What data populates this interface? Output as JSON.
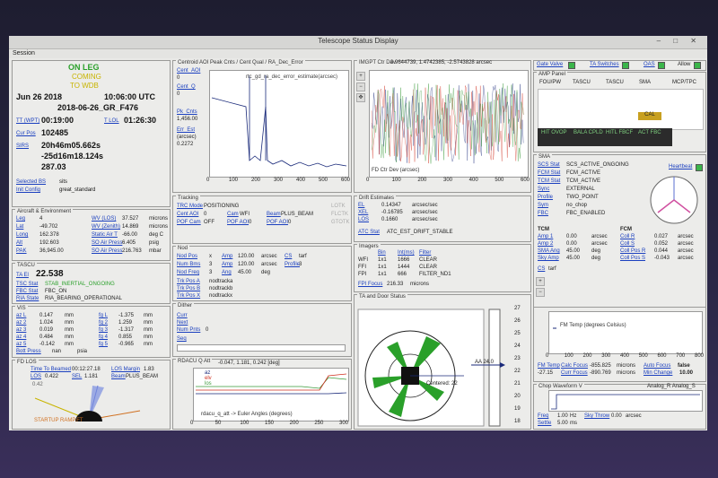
{
  "window": {
    "title": "Telescope Status Display",
    "menu": "Session"
  },
  "flight": {
    "leg_status": "ON LEG",
    "status_line2": "COMING",
    "status_line3": "TO WDB",
    "date": "Jun 26 2018",
    "time_utc": "10:06:00 UTC",
    "flight_id": "2018-06-26_GR_F476",
    "tt_label": "TT (WPT)",
    "tt": "00:19:00",
    "tlol_label": "T LOL",
    "tlol": "01:26:30",
    "curpos_label": "Cur Pos",
    "curpos": "102485",
    "sirs_label": "SIRS",
    "ra": "20h46m05.662s",
    "dec": "-25d16m18.124s",
    "pa": "287.03",
    "sel_label": "Selected BS",
    "sel_val": "sits",
    "init_label": "Init Config",
    "init_val": "great_standard"
  },
  "aircraft": {
    "title": "Aircraft & Environment",
    "rows": [
      [
        "Leg",
        "4",
        "WV (LOS)",
        "37.527",
        "microns"
      ],
      [
        "Lat",
        "-49.702",
        "WV (Zenith)",
        "14.869",
        "microns"
      ],
      [
        "Long",
        "162.378",
        "Static Air T",
        "-66.00",
        "deg C"
      ],
      [
        "Alt",
        "192.603",
        "SO Air Press",
        "6.405",
        "psig"
      ],
      [
        "PAK",
        "36,945.00",
        "SO Air Press",
        "216.763",
        "mbar"
      ]
    ]
  },
  "tasco": {
    "title": "TASCU",
    "ta_label": "TA El",
    "ta_val": "22.538",
    "tsc_label": "TSC Stat",
    "tsc_val": "STAB_INERTIAL_ONGOING",
    "fbc_label": "FBC Stat",
    "fbc_val": "FBC_ON",
    "ria_label": "RIA State",
    "ria_val": "RIA_BEARING_OPERATIONAL"
  },
  "vis": {
    "title": "VIS",
    "rows": [
      [
        "az L",
        "0.147",
        "mm",
        "fg L",
        "-1.375",
        "mm"
      ],
      [
        "az 2",
        "1.024",
        "mm",
        "fg 2",
        "1.259",
        "mm"
      ],
      [
        "az 3",
        "0.019",
        "mm",
        "fg 3",
        "-1.317",
        "mm"
      ],
      [
        "az 4",
        "0.484",
        "mm",
        "fg 4",
        "0.855",
        "mm"
      ],
      [
        "az 5",
        "-0.142",
        "mm",
        "fg 5",
        "-0.965",
        "mm"
      ]
    ],
    "bott_label": "Bott Press",
    "bott_val": "nan",
    "bott_unit": "psia"
  },
  "fdlos": {
    "title": "FD LOS",
    "ttb_label": "Time To Beamed",
    "ttb_val": "00:12:27.18",
    "losm_label": "LOS Margin",
    "losm_val": "1.83",
    "los_label": "LOS",
    "los_val": "0.422",
    "sel_label": "SEL",
    "sel_val": "1.181",
    "beam_label": "Beam",
    "beam_val": "PLUS_BEAM",
    "gauge_value": "0.42",
    "gauge_note": "STARTUP RAMP.FT"
  },
  "centroid": {
    "title": "Centroid AOI Peak Cnts / Cent Qual / RA_Dec_Error",
    "labels": [
      "Cent_AOI",
      "0",
      "Cent_Q",
      "0",
      "Pk_Cnts",
      "1,456.00",
      "Err_Est",
      "(arcsec)",
      "0.2272"
    ],
    "legend": "rtc_gd_ra_dec_error_estimate(arcsec)",
    "xticks": [
      "0",
      "100",
      "200",
      "300",
      "400",
      "500",
      "600"
    ]
  },
  "tracking": {
    "title": "Tracking",
    "trc_label": "TRC Mode",
    "trc_val": "POSITIONING",
    "cent_label": "Cent AOI",
    "cent_val": "0",
    "cam_label": "Cam",
    "cam_val": "WFI",
    "beam_label": "Beam",
    "beam_val": "PLUS_BEAM",
    "pof_label": "POF Cam",
    "pof_val": "OFF",
    "pofaoi_label": "POF AOI",
    "pofaoi_val": "0",
    "pofaoi2_label": "POF AOI",
    "pofaoi2_val": "0",
    "lotk": "LOTK",
    "flctk": "FLCTK",
    "gtotk": "GTOTK"
  },
  "nod": {
    "title": "Nod",
    "rows": [
      [
        "Nod Pos",
        "x",
        "Amp",
        "120.00",
        "arcsec",
        "CS",
        "tarf"
      ],
      [
        "Num Bms",
        "3",
        "Amp",
        "120.00",
        "arcsec",
        "Profile",
        "3"
      ],
      [
        "Nod Freq",
        "3",
        "Ang",
        "45.00",
        "deg",
        "",
        ""
      ]
    ],
    "trk": [
      [
        "Trk Pos A",
        "nodtracka"
      ],
      [
        "Trk Pos B",
        "nodtrackb"
      ],
      [
        "Trk Pos X",
        "nodtrackx"
      ]
    ]
  },
  "dither": {
    "title": "Dither",
    "cur": "Curr",
    "next": "Next",
    "num_label": "Num Pnts",
    "num_val": "0",
    "seq": "Seq"
  },
  "rdacu": {
    "title": "RDACU Q Att",
    "values": "-0.047, 1.181, 0.242 [deg]",
    "legend": [
      "az",
      "elv",
      "los"
    ],
    "footer": "rdacu_q_att -> Euler Angles (degrees)",
    "xticks": [
      "0",
      "50",
      "100",
      "150",
      "200",
      "250",
      "300"
    ]
  },
  "imgplot": {
    "title": "IMGPT Ctr Dev",
    "values": "3.9644739, 1.4742385, -2.5743828 arcsec",
    "legend": "FD Ctr Dev (arcsec)",
    "xticks": [
      "0",
      "100",
      "200",
      "300",
      "400",
      "500",
      "600"
    ]
  },
  "drift": {
    "title": "Drift Estimates",
    "rows": [
      [
        "EL",
        "0.14347",
        "arcsec/sec"
      ],
      [
        "XEL",
        "-0.16785",
        "arcsec/sec"
      ],
      [
        "LOS",
        "0.1660",
        "arcsec/sec"
      ]
    ],
    "atc_label": "ATC Stat",
    "atc_val": "ATC_EST_DRIFT_STABLE"
  },
  "imagers": {
    "title": "Imagers",
    "head": [
      "Bin",
      "Int(ms)",
      "Filter"
    ],
    "rows": [
      [
        "WFI",
        "1x1",
        "1666",
        "CLEAR"
      ],
      [
        "FFI",
        "1x1",
        "1444",
        "CLEAR"
      ],
      [
        "FPI",
        "1x1",
        "666",
        "FILTER_ND1"
      ]
    ],
    "focus_label": "FPI Focus",
    "focus_val": "216.33",
    "focus_unit": "microns"
  },
  "tadoor": {
    "title": "TA and Door Status",
    "centered": "Centered: 22",
    "marker": "AA 24.0",
    "scale": [
      "27",
      "26",
      "25",
      "24",
      "23",
      "22",
      "21",
      "20",
      "19",
      "18"
    ]
  },
  "topbar": {
    "gate": "Gate Valve",
    "ta_sw": "TA Switches",
    "oas": "OAS",
    "allow": "Allow"
  },
  "amp": {
    "title": "AMP Panel",
    "heads": [
      "FOU/PW",
      "TASCU",
      "TASCU",
      "SMA",
      "MCP/TPC"
    ],
    "cal": "CAL",
    "cells": [
      "HIT_OVOP",
      "BALA_CPLD",
      "HITL_FBCF",
      "ACT_FBC"
    ]
  },
  "sma": {
    "title": "SMA",
    "rows": [
      [
        "SCS Stat",
        "SCS_ACTIVE_ONGOING"
      ],
      [
        "FCM Stat",
        "FCM_ACTIVE"
      ],
      [
        "TCM Stat",
        "TCM_ACTIVE"
      ],
      [
        "Sync",
        "EXTERNAL"
      ],
      [
        "Profile",
        "TWO_POINT"
      ],
      [
        "Sym",
        "no_chop"
      ],
      [
        "FBC",
        "FBC_ENABLED"
      ]
    ],
    "heartbeat": "Heartbeat",
    "tcm": "TCM",
    "fcm": "FCM",
    "tcm_rows": [
      [
        "Amp 1",
        "0.00",
        "arcsec"
      ],
      [
        "Amp 2",
        "0.00",
        "arcsec"
      ],
      [
        "SMA Ang",
        "45.00",
        "deg"
      ],
      [
        "Sky Amp",
        "45.00",
        "deg"
      ]
    ],
    "fcm_rows": [
      [
        "Coll R",
        "0.027",
        "arcsec"
      ],
      [
        "Coll S",
        "0.052",
        "arcsec"
      ],
      [
        "Coll Pos R",
        "0.044",
        "arcsec"
      ],
      [
        "Coll Pos S",
        "-0.043",
        "arcsec"
      ]
    ],
    "cs_label": "CS",
    "cs_val": "tarf"
  },
  "fmtemp": {
    "legend": "FM Temp (degrees Celsius)",
    "temp_label": "FM Temp",
    "temp_val": "-27.15",
    "calc_label": "Calc Focus",
    "calc_val": "-855.825",
    "calc_unit": "microns",
    "auto_label": "Auto Focus",
    "auto_val": "false",
    "curf_label": "Curr Focus",
    "curf_val": "-890.769",
    "curf_unit": "microns",
    "mchg_label": "Min Change",
    "mchg_val": "10.00",
    "xticks": [
      "0",
      "100",
      "200",
      "300",
      "400",
      "500",
      "600",
      "700",
      "800"
    ]
  },
  "chop": {
    "title": "Chop Waveform V",
    "title2": "Analog_R Analog_S",
    "freq_label": "Freq",
    "freq_val": "1.00",
    "freq_unit": "Hz",
    "skyt_label": "Sky Throw",
    "skyt_val": "0.00",
    "skyt_unit": "arcsec",
    "settle_label": "Settle",
    "settle_val": "5.00",
    "settle_unit": "ms"
  },
  "colors": {
    "green": "#2aa02a",
    "amber": "#c8b400",
    "red": "#d03020",
    "blue": "#1a3fbf",
    "dark": "#2b2b2b"
  }
}
